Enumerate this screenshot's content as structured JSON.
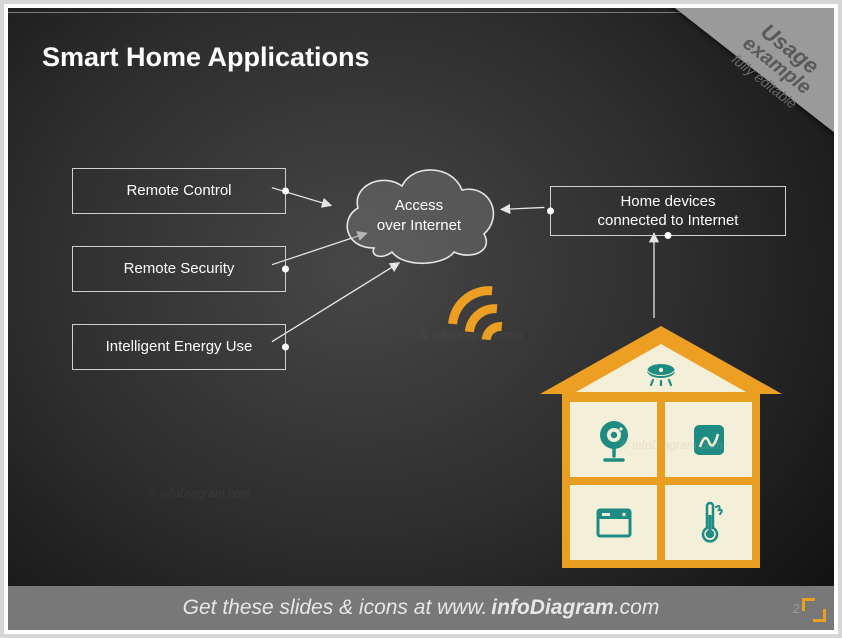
{
  "slide": {
    "title": "Smart Home Applications",
    "page_number": "2",
    "corner": {
      "line1": "Usage",
      "line2": "example",
      "line3": "fully editable"
    },
    "cloud_label": "Access\nover Internet",
    "boxes": {
      "remote_control": "Remote Control",
      "remote_security": "Remote Security",
      "intelligent_energy": "Intelligent Energy Use",
      "home_devices": "Home devices\nconnected to Internet"
    },
    "footer": {
      "prefix": "Get these slides & icons at www.",
      "bold": "infoDiagram",
      "suffix": ".com"
    },
    "icons": {
      "attic": "smoke-detector-icon",
      "room_tl": "webcam-icon",
      "room_tr": "panel-icon",
      "room_bl": "dishwasher-icon",
      "room_br": "thermometer-icon"
    },
    "watermark": "© infoDiagram.com"
  }
}
